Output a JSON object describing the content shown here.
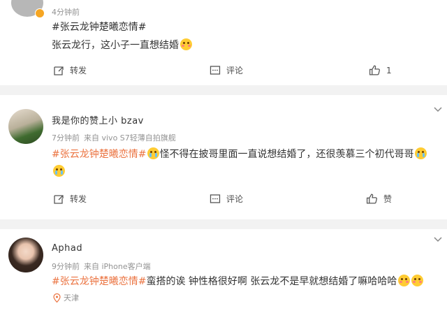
{
  "colors": {
    "hashtag": "#eb7340",
    "meta": "#939393",
    "separator": "#f2f2f2"
  },
  "post1": {
    "time": "4分钟前",
    "hashtag": "#张云龙钟楚曦恋情#",
    "text": "张云龙行，这小子一直想结婚",
    "emoji": "blush-emoji",
    "actions": {
      "repost": "转发",
      "comment": "评论",
      "like": "1"
    }
  },
  "post2": {
    "username": "我是你的赞上小  bzav",
    "time": "7分钟前",
    "source": "来自 vivo S7轻薄自拍旗舰",
    "hashtag": "#张云龙钟楚曦恋情#",
    "text_line1": "怪不得在披哥里面一直说想结婚了，还很羡慕三个初代哥哥",
    "actions": {
      "repost": "转发",
      "comment": "评论",
      "like": "赞"
    }
  },
  "post3": {
    "username": "Aphad",
    "time": "9分钟前",
    "source": "来自 iPhone客户端",
    "hashtag": "#张云龙钟楚曦恋情#",
    "text": "蛮搭的诶 钟性格很好啊 张云龙不是早就想结婚了嘛哈哈哈",
    "location": "天津"
  }
}
